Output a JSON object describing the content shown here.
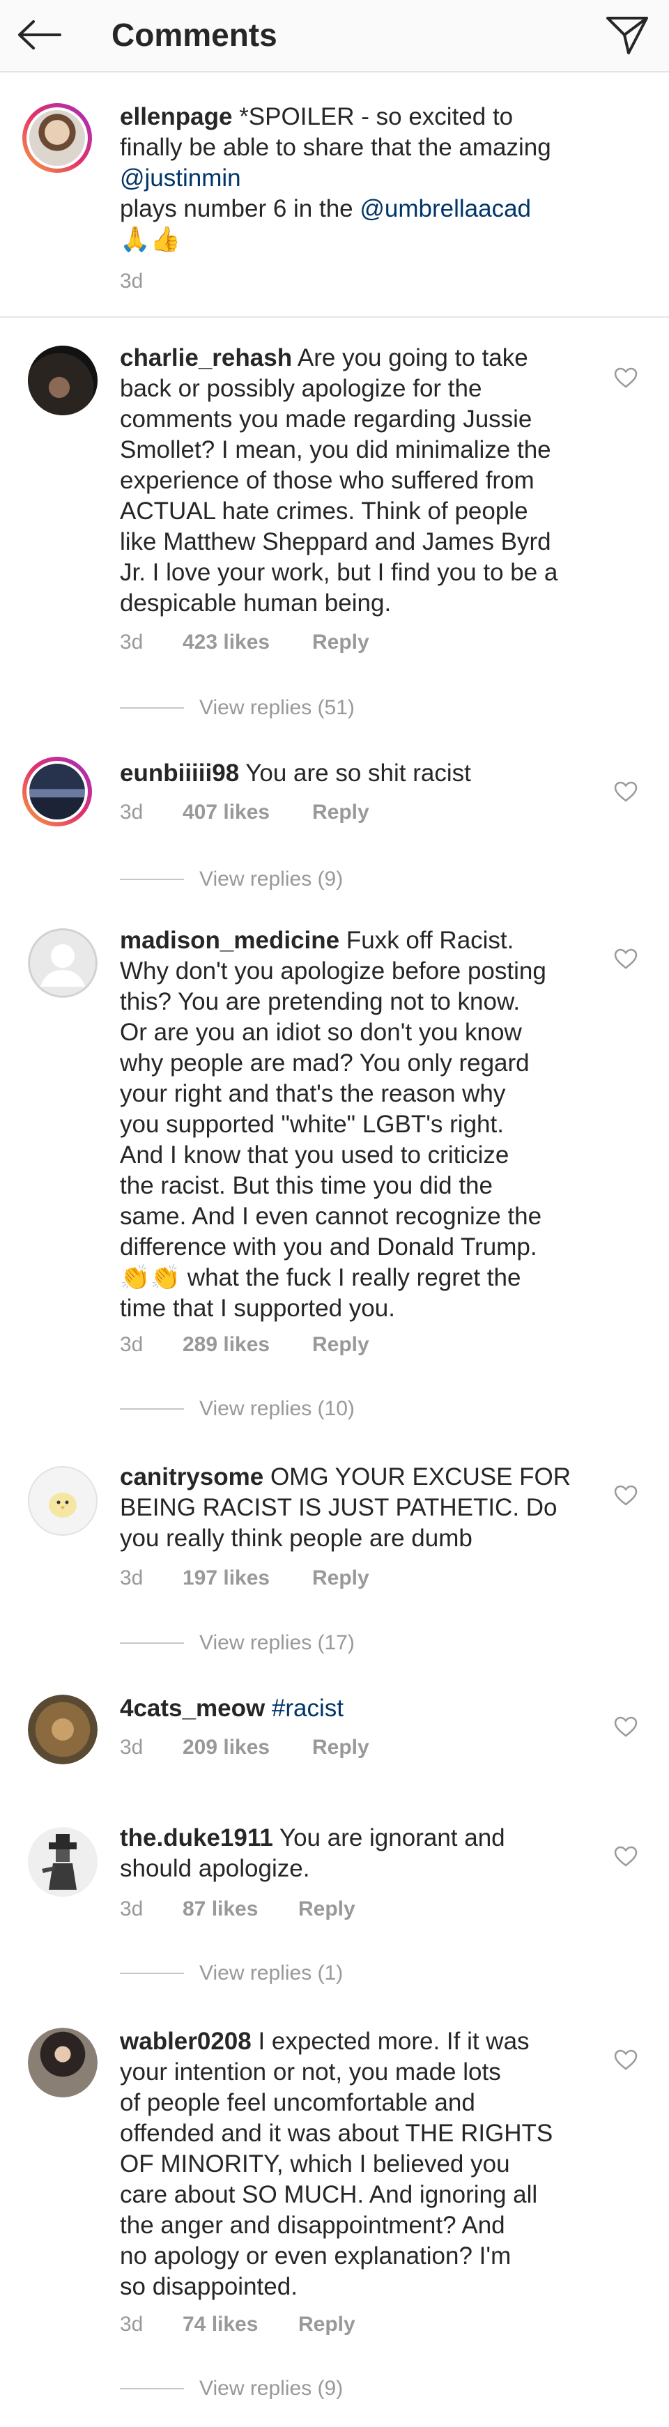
{
  "header": {
    "title": "Comments",
    "back_icon": "arrow-left-icon",
    "send_icon": "paper-plane-icon"
  },
  "post": {
    "username": "ellenpage",
    "text_1": "*SPOILER - so excited to",
    "text_2": "finally be able to share that the amazing",
    "mention_1": "@justinmin",
    "text_3": "plays number 6 in the",
    "mention_2": "@umbrellaacad",
    "emoji": "🙏👍",
    "time": "3d"
  },
  "comments": [
    {
      "username": "charlie_rehash",
      "lines": [
        "Are you going to take",
        "back or possibly apologize for the",
        "comments you made regarding Jussie",
        "Smollet? I mean, you did minimalize the",
        "experience of those who suffered from",
        "ACTUAL hate crimes. Think of people",
        "like Matthew Sheppard and James Byrd",
        "Jr. I love your work, but I find you to be a",
        "despicable human being."
      ],
      "time": "3d",
      "likes": "423 likes",
      "reply": "Reply",
      "view_replies": "View replies (51)"
    },
    {
      "username": "eunbiiiii98",
      "lines": [
        "You are so shit racist"
      ],
      "time": "3d",
      "likes": "407 likes",
      "reply": "Reply",
      "view_replies": "View replies (9)"
    },
    {
      "username": "madison_medicine",
      "lines": [
        "Fuxk off Racist.",
        "Why don't you apologize before posting",
        "this? You are pretending not to know.",
        "Or are you an idiot so don't you know",
        "why people are mad? You only regard",
        "your right and that's the reason why",
        "you supported \"white\" LGBT's right.",
        "And I know that you used to criticize",
        "the racist. But this time you did the",
        "same. And I even cannot recognize the",
        "difference with you and Donald Trump.",
        "👏👏 what the fuck I really regret the",
        "time that  I supported you."
      ],
      "time": "3d",
      "likes": "289 likes",
      "reply": "Reply",
      "view_replies": "View replies (10)"
    },
    {
      "username": "canitrysome",
      "lines": [
        "OMG YOUR EXCUSE FOR",
        "BEING RACIST IS JUST PATHETIC. Do",
        "you really think people are dumb"
      ],
      "time": "3d",
      "likes": "197 likes",
      "reply": "Reply",
      "view_replies": "View replies (17)"
    },
    {
      "username": "4cats_meow",
      "lines": [
        "#racist"
      ],
      "time": "3d",
      "likes": "209 likes",
      "reply": "Reply"
    },
    {
      "username": "the.duke1911",
      "lines": [
        "You are ignorant and",
        "should apologize."
      ],
      "time": "3d",
      "likes": "87 likes",
      "reply": "Reply",
      "view_replies": "View replies (1)"
    },
    {
      "username": "wabler0208",
      "lines": [
        "I expected more. If it was",
        "your intention or not, you made lots",
        "of people feel uncomfortable and",
        "offended and it was about THE RIGHTS",
        "OF MINORITY, which I believed you",
        "care about SO MUCH. And ignoring all",
        "the anger and disappointment? And",
        "no apology or even  explanation? I'm",
        "so disappointed."
      ],
      "time": "3d",
      "likes": "74 likes",
      "reply": "Reply",
      "view_replies": "View replies (9)"
    }
  ],
  "colors": {
    "text": "#262626",
    "muted": "#999999",
    "link": "#003569",
    "divider": "#e6e6e6"
  }
}
